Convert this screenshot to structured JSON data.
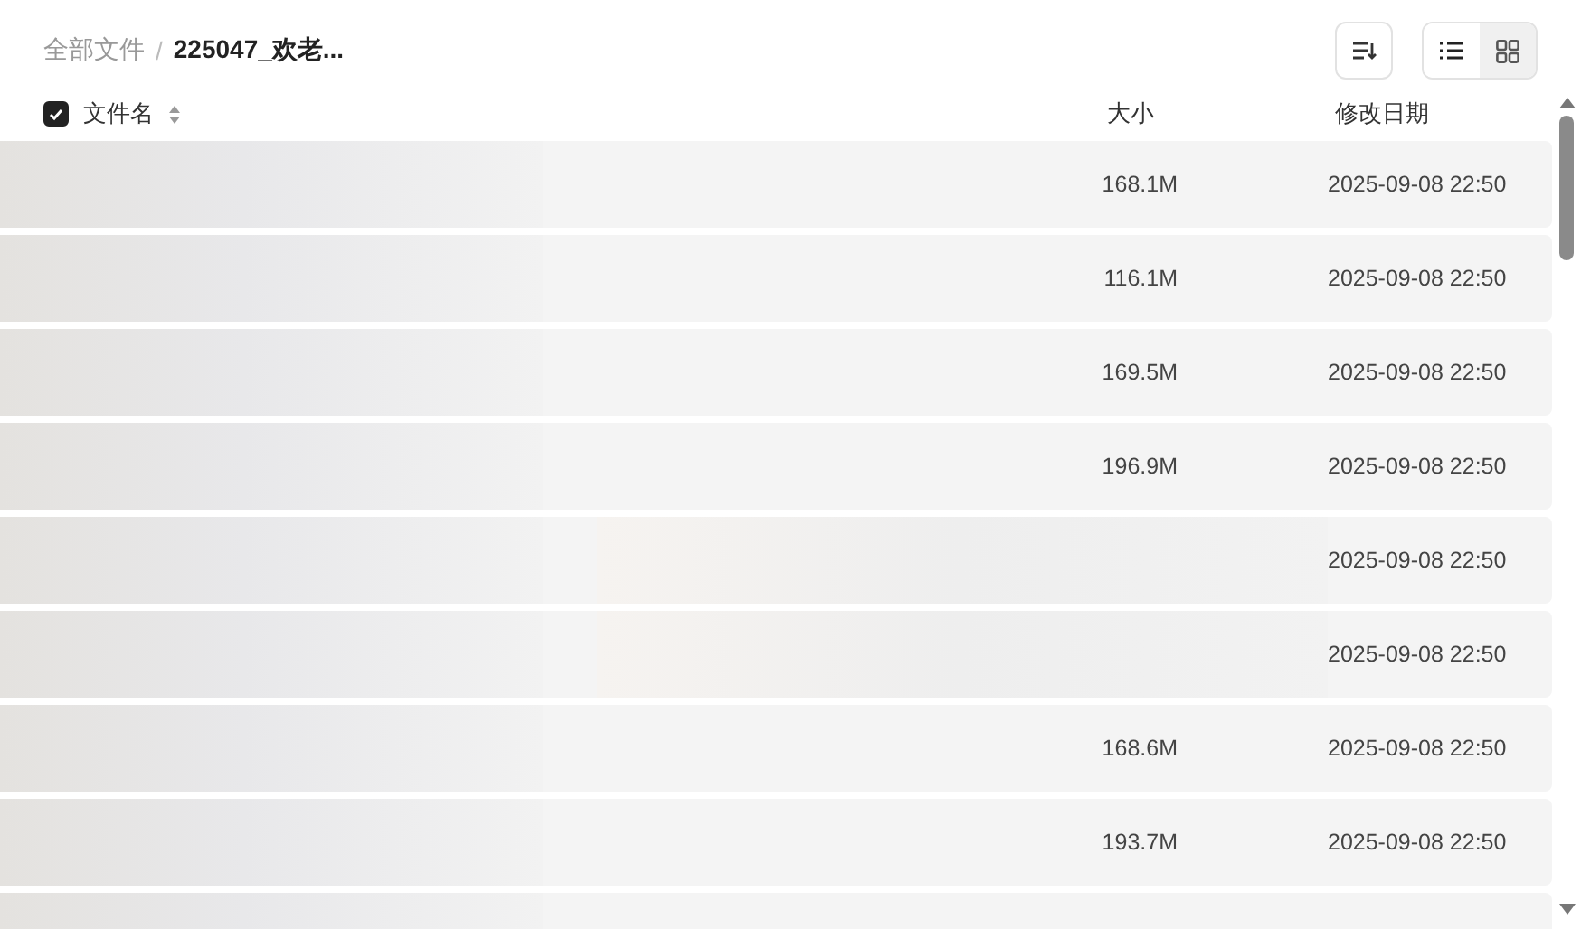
{
  "breadcrumb_separator": "/",
  "breadcrumb": [
    {
      "label": "全部文件",
      "current": false
    },
    {
      "label": "225047_欢老...",
      "current": true
    }
  ],
  "view_modes": [
    {
      "kind": "list",
      "selected": true
    },
    {
      "kind": "grid",
      "selected": false
    }
  ],
  "table": {
    "select_all_checked": true,
    "columns": [
      "文件名",
      "大小",
      "修改日期"
    ],
    "rows": [
      {
        "size": "168.1M",
        "modified": "2025-09-08 22:50"
      },
      {
        "size": "116.1M",
        "modified": "2025-09-08 22:50"
      },
      {
        "size": "169.5M",
        "modified": "2025-09-08 22:50"
      },
      {
        "size": "196.9M",
        "modified": "2025-09-08 22:50"
      },
      {
        "modified": "2025-09-08 22:50"
      },
      {
        "modified": "2025-09-08 22:50"
      },
      {
        "size": "168.6M",
        "modified": "2025-09-08 22:50"
      },
      {
        "size": "193.7M",
        "modified": "2025-09-08 22:50"
      }
    ]
  }
}
